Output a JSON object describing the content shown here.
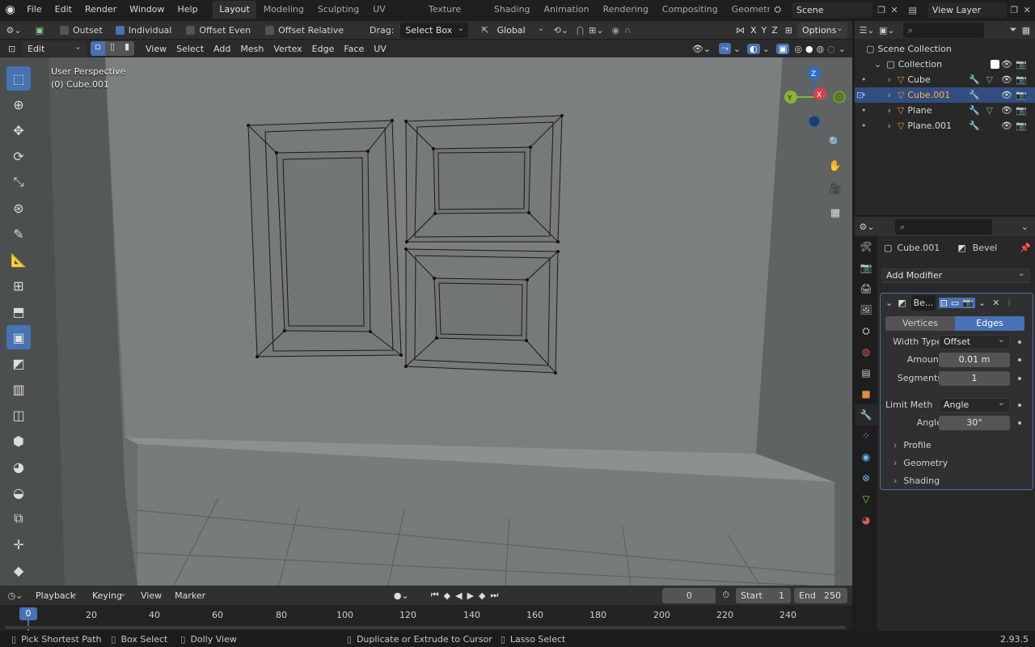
{
  "topbar": {
    "menus": [
      "File",
      "Edit",
      "Render",
      "Window",
      "Help"
    ],
    "workspaces": [
      "Layout",
      "Modeling",
      "Sculpting",
      "UV Editing",
      "Texture Paint",
      "Shading",
      "Animation",
      "Rendering",
      "Compositing",
      "Geometr"
    ],
    "active_workspace": "Layout",
    "scene": "Scene",
    "view_layer": "View Layer"
  },
  "tool_settings": {
    "outset": "Outset",
    "individual": "Individual",
    "offset_even": "Offset Even",
    "offset_relative": "Offset Relative",
    "drag_label": "Drag:",
    "drag_value": "Select Box",
    "orientation": "Global",
    "axes": [
      "X",
      "Y",
      "Z"
    ],
    "options": "Options"
  },
  "header": {
    "mode": "Edit Mode",
    "menus": [
      "View",
      "Select",
      "Add",
      "Mesh",
      "Vertex",
      "Edge",
      "Face",
      "UV"
    ]
  },
  "viewport": {
    "perspective": "User Perspective",
    "object": "(0) Cube.001",
    "gizmo": {
      "z": "Z",
      "y": "Y",
      "x": "X"
    }
  },
  "outliner": {
    "search_placeholder": "",
    "scene_collection": "Scene Collection",
    "collection": "Collection",
    "items": [
      {
        "name": "Cube",
        "selected": false
      },
      {
        "name": "Cube.001",
        "selected": true
      },
      {
        "name": "Plane",
        "selected": false
      },
      {
        "name": "Plane.001",
        "selected": false
      }
    ]
  },
  "properties": {
    "object": "Cube.001",
    "modifier_tab": "Bevel",
    "add_modifier": "Add Modifier",
    "modifier_name": "Be...",
    "affect": [
      "Vertices",
      "Edges"
    ],
    "affect_active": "Edges",
    "width_type_label": "Width Type",
    "width_type": "Offset",
    "amount_label": "Amount",
    "amount": "0.01 m",
    "segments_label": "Segments",
    "segments": "1",
    "limit_label": "Limit Meth",
    "limit": "Angle",
    "angle_label": "Angle",
    "angle": "30°",
    "subpanels": [
      "Profile",
      "Geometry",
      "Shading"
    ]
  },
  "timeline": {
    "menus": [
      "Playback",
      "Keying",
      "View",
      "Marker"
    ],
    "current_frame": "0",
    "start_label": "Start",
    "start": "1",
    "end_label": "End",
    "end": "250",
    "ticks": [
      "0",
      "20",
      "40",
      "60",
      "80",
      "100",
      "120",
      "140",
      "160",
      "180",
      "200",
      "220",
      "240"
    ]
  },
  "statusbar": {
    "items": [
      "Pick Shortest Path",
      "Box Select",
      "Dolly View",
      "Duplicate or Extrude to Cursor",
      "Lasso Select"
    ],
    "version": "2.93.5"
  },
  "colors": {
    "accent": "#4772b3",
    "selected_row": "#334d80",
    "timeline_cursor": "#4772b3"
  }
}
